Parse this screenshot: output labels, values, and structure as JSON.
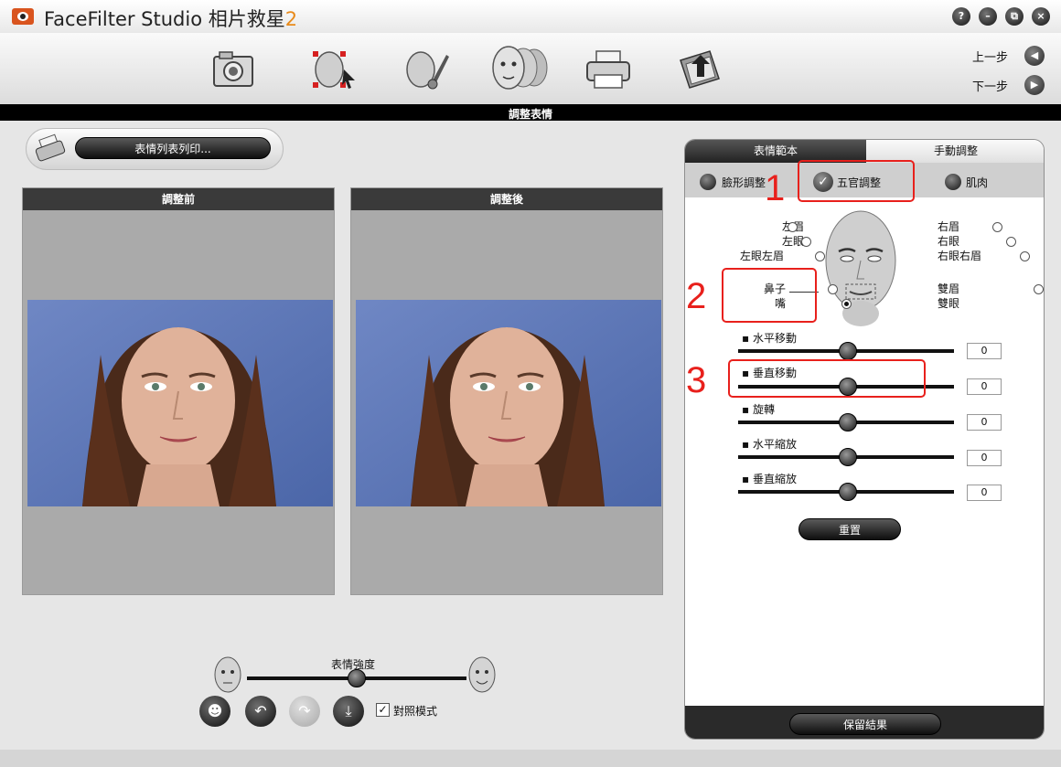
{
  "app": {
    "title_text": "FaceFilter Studio 相片救星",
    "title_version": "2"
  },
  "window_buttons": [
    "?",
    "–",
    "⧉",
    "×"
  ],
  "nav": {
    "prev": "上一步",
    "next": "下一步"
  },
  "section_title": "調整表情",
  "print": {
    "label": "表情列表列印..."
  },
  "preview": {
    "before": "調整前",
    "after": "調整後"
  },
  "bottom": {
    "intensity_label": "表情強度",
    "intensity_value": 0.5,
    "compare_label": "對照模式",
    "compare_checked": true
  },
  "right_panel": {
    "tabs": [
      "表情範本",
      "手動調整"
    ],
    "subtabs": [
      "臉形調整",
      "五官調整",
      "肌肉"
    ],
    "features_left": [
      {
        "label": "左眉",
        "selected": false
      },
      {
        "label": "左眼",
        "selected": false
      },
      {
        "label": "左眼左眉",
        "selected": false
      },
      {
        "label": "鼻子",
        "selected": false
      },
      {
        "label": "嘴",
        "selected": true
      }
    ],
    "features_right": [
      {
        "label": "右眉",
        "selected": false
      },
      {
        "label": "右眼",
        "selected": false
      },
      {
        "label": "右眼右眉",
        "selected": false
      },
      {
        "label": "雙眉",
        "selected": false
      },
      {
        "label": "雙眼",
        "selected": false
      }
    ],
    "sliders": [
      {
        "label": "水平移動",
        "value": "0"
      },
      {
        "label": "垂直移動",
        "value": "0"
      },
      {
        "label": "旋轉",
        "value": "0"
      },
      {
        "label": "水平縮放",
        "value": "0"
      },
      {
        "label": "垂直縮放",
        "value": "0"
      }
    ],
    "reset_label": "重置",
    "keep_label": "保留結果"
  },
  "annotations": [
    "1",
    "2",
    "3"
  ],
  "colors": {
    "annotation_red": "#e8201c",
    "title_accent": "#e88a1a"
  }
}
